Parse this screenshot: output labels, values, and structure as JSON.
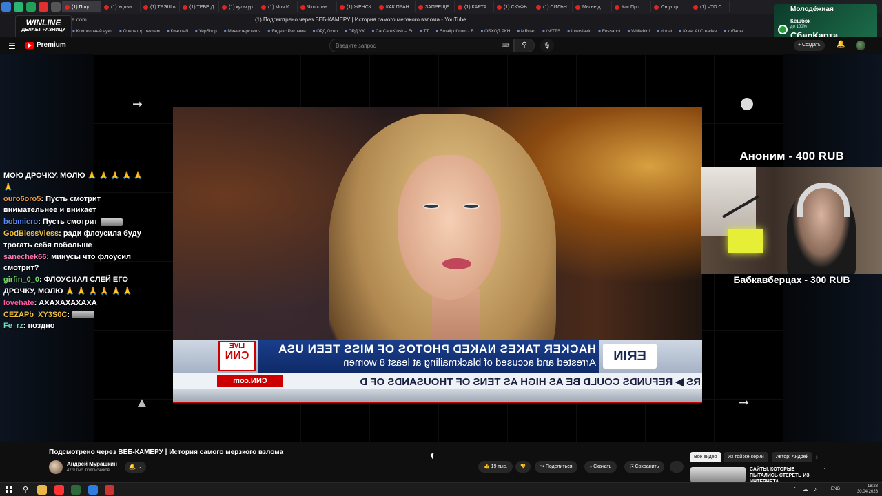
{
  "browser": {
    "tabs": [
      {
        "label": "(1) Подс"
      },
      {
        "label": "(1) Удиви"
      },
      {
        "label": "(1) ТРЭШ в"
      },
      {
        "label": "(1) ТЕБЕ Д"
      },
      {
        "label": "(1) культур"
      },
      {
        "label": "(1) Моя И"
      },
      {
        "label": "Что слав"
      },
      {
        "label": "(1) ЖЕНСК"
      },
      {
        "label": "КАК ПРАН"
      },
      {
        "label": "ЗАПРЕЩЕ"
      },
      {
        "label": "(1) КАРТА"
      },
      {
        "label": "(1) СКУФЬ"
      },
      {
        "label": "(1) СИЛЬН"
      },
      {
        "label": "Мы не д"
      },
      {
        "label": "Как Про"
      },
      {
        "label": "Он устр"
      },
      {
        "label": "(1) ЧТО С"
      }
    ],
    "window_title": "(1) Подсмотрено через ВЕБ-КАМЕРУ | История самого мерзкого взлома - YouTube",
    "url_fragment": "e.com",
    "bookmarks": [
      "Компотовый аукц",
      "Оператор реклам",
      "Кинопаб",
      "YepShop",
      "Министерство э",
      "Яндекс Рекламн",
      "ОРД Ozon",
      "ОРД VK",
      "CarCareKiosk – Fr",
      "TT",
      "Smallpdf.com - Б",
      "ОБХОД РКН",
      "MRoad",
      "/N/TTS",
      "Interslavic",
      "Fossabot",
      "Whitebird",
      "donat",
      "Krea: AI Creative",
      "кобальт"
    ]
  },
  "ads": {
    "winline_brand": "WINLINE",
    "winline_tag": "ДЕЛАЕТ РАЗНИЦУ",
    "sber_line1": "Молодёжная",
    "sber_line2": "Кешбэк",
    "sber_line3": "до 100%",
    "sber_line4": "СберКарта"
  },
  "youtube": {
    "logo_text": "Premium",
    "search_placeholder": "Введите запрос",
    "create_label": "Создать"
  },
  "video": {
    "chyron_headline": "HACKER TAKES NAKED PHOTOS OF MISS TEEN USA",
    "chyron_sub": "Arrested and accused of blackmailing at least 8 women",
    "chyron_live": "LIVE",
    "chyron_brand": "CNN",
    "chyron_show": "ERIN",
    "chyron_site": "CNN.com",
    "chyron_ticker": "RS ▶ REFUNDS COULD BE AS HIGH AS TENS OF THOUSANDS OF D"
  },
  "chat": [
    {
      "user": "",
      "text": "МОЮ ДРОЧКУ, МОЛЮ 🙏 🙏 🙏 🙏 🙏 🙏"
    },
    {
      "user": "ouro6oro5",
      "text": ": Пусть смотрит внимательнее и вникает",
      "user_color": "#f0a040"
    },
    {
      "user": "bobmicro",
      "text": ": Пусть смотрит",
      "user_color": "#5a8cff"
    },
    {
      "user": "GodBlessVless",
      "text": ": ради флоусила буду трогать себя побольше",
      "user_color": "#f0c040"
    },
    {
      "user": "sanechek66",
      "text": ": минусы что флоусил смотрит?",
      "user_color": "#ff7ab0"
    },
    {
      "user": "girfin_0_0",
      "text": ": ФЛОУСИАЛ СЛЕЙ ЕГО ДРОЧКУ, МОЛЮ 🙏 🙏 🙏 🙏 🙏 🙏",
      "user_color": "#7ad66a"
    },
    {
      "user": "lovehate",
      "text": ": АХАХАХАХАХА",
      "user_color": "#ff5aa0"
    },
    {
      "user": "CEZAPb_XY3S0C",
      "text": ":",
      "user_color": "#f0c040"
    },
    {
      "user": "Fe_rz",
      "text": ": поздно",
      "user_color": "#6adcc0"
    }
  ],
  "donations": {
    "top": "Аноним - 400 RUB",
    "bottom": "Бабкавберцах - 300 RUB"
  },
  "below_video": {
    "title": "Подсмотрено через ВЕБ-КАМЕРУ | История самого мерзкого взлома",
    "channel_name": "Андрей Мурашкин",
    "subscribers": "47,9 тыс. подписчиков",
    "like_count": "19 тыс.",
    "share_label": "Поделиться",
    "download_label": "Скачать",
    "save_label": "Сохранить",
    "chips": [
      "Все видео",
      "Из той же серии",
      "Автор: Андрей"
    ],
    "rec_title": "САЙТЫ, КОТОРЫЕ ПЫТАЛИСЬ СТЕРЕТЬ ИЗ ИНТЕРНЕТА"
  },
  "taskbar": {
    "lang": "ENG",
    "time": "18:28",
    "date": "30.04.2026"
  },
  "colors": {
    "yt_red": "#ff0000",
    "bg": "#0f0f0f",
    "chyron_blue": "#1a3e8c"
  }
}
